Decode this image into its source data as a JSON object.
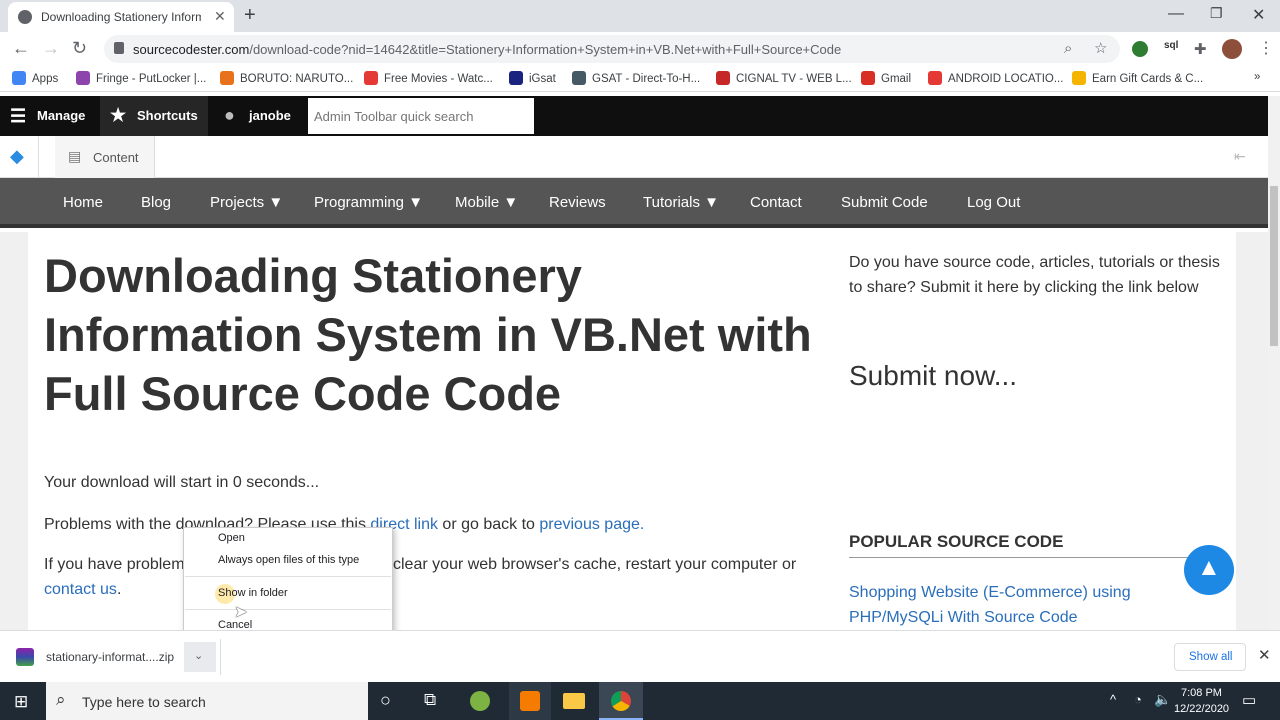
{
  "browser": {
    "tab_title": "Downloading Stationery Informa",
    "url_domain": "sourcecodester.com",
    "url_path": "/download-code?nid=14642&title=Stationery+Information+System+in+VB.Net+with+Full+Source+Code"
  },
  "bookmarks": [
    {
      "label": "Apps",
      "color": "#4285f4"
    },
    {
      "label": "Fringe - PutLocker |...",
      "color": "#8e44ad"
    },
    {
      "label": "BORUTO: NARUTO...",
      "color": "#e8711c"
    },
    {
      "label": "Free Movies - Watc...",
      "color": "#e53935"
    },
    {
      "label": "iGsat",
      "color": "#1a237e"
    },
    {
      "label": "GSAT - Direct-To-H...",
      "color": "#455a64"
    },
    {
      "label": "CIGNAL TV - WEB L...",
      "color": "#c62828"
    },
    {
      "label": "Gmail",
      "color": "#d93025"
    },
    {
      "label": "ANDROID LOCATIO...",
      "color": "#e53935"
    },
    {
      "label": "Earn Gift Cards & C...",
      "color": "#f4b400"
    }
  ],
  "admin_toolbar": {
    "manage": "Manage",
    "shortcuts": "Shortcuts",
    "user": "janobe",
    "search_placeholder": "Admin Toolbar quick search",
    "content": "Content"
  },
  "site_nav": [
    {
      "label": "Home",
      "dropdown": false
    },
    {
      "label": "Blog",
      "dropdown": false
    },
    {
      "label": "Projects",
      "dropdown": true
    },
    {
      "label": "Programming",
      "dropdown": true
    },
    {
      "label": "Mobile",
      "dropdown": true
    },
    {
      "label": "Reviews",
      "dropdown": false
    },
    {
      "label": "Tutorials",
      "dropdown": true
    },
    {
      "label": "Contact",
      "dropdown": false
    },
    {
      "label": "Submit Code",
      "dropdown": false
    },
    {
      "label": "Log Out",
      "dropdown": false
    }
  ],
  "main": {
    "title": "Downloading Stationery Information System in VB.Net with Full Source Code Code",
    "countdown": "Your download will start in 0 seconds...",
    "problems_prefix": "Problems with the download? Please use this ",
    "direct_link": "direct link",
    "problems_mid": " or go back to ",
    "previous_page": "previous page",
    "problems_suffix": ".",
    "if_problems_prefix": "If you have problem",
    "if_problems_rest": " clear your web browser's cache, restart your computer or",
    "contact_us": "contact us",
    "contact_suffix": "."
  },
  "sidebar": {
    "prompt": "Do you have source code, articles, tutorials or thesis to share? Submit it here by clicking the link below",
    "submit_now": "Submit now...",
    "popular_heading": "POPULAR SOURCE CODE",
    "popular_item": "Shopping Website (E-Commerce) using PHP/MySQLi With Source Code"
  },
  "context_menu": {
    "items": [
      "Open",
      "Always open files of this type",
      "Show in folder",
      "Cancel"
    ]
  },
  "download_bar": {
    "filename": "stationary-informat....zip",
    "show_all": "Show all"
  },
  "taskbar": {
    "search_placeholder": "Type here to search",
    "time": "7:08 PM",
    "date": "12/22/2020"
  },
  "colors": {
    "link": "#2a6ebb",
    "nav_bg": "#555555",
    "admin_bg": "#0f0f0f",
    "scroll_top_button": "#1e88e5"
  }
}
